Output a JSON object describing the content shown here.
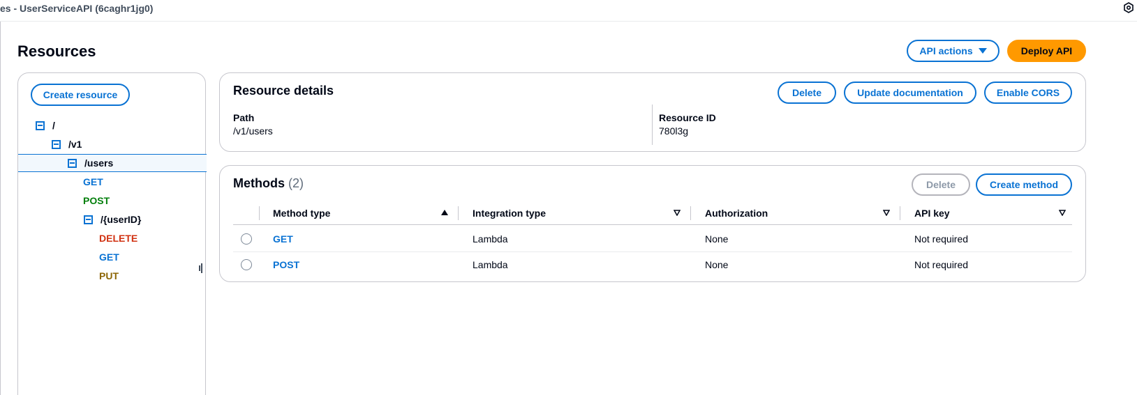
{
  "topbar": {
    "title": "es - UserServiceAPI (6caghr1jg0)",
    "icon": "hexagon-settings-icon"
  },
  "page": {
    "title": "Resources"
  },
  "header_actions": {
    "api_actions_label": "API actions",
    "deploy_label": "Deploy API"
  },
  "tree": {
    "create_resource_label": "Create resource",
    "nodes": [
      {
        "label": "/",
        "kind": "resource"
      },
      {
        "label": "/v1",
        "kind": "resource"
      },
      {
        "label": "/users",
        "kind": "resource",
        "selected": true
      },
      {
        "label": "GET",
        "kind": "method"
      },
      {
        "label": "POST",
        "kind": "method"
      },
      {
        "label": "/{userID}",
        "kind": "resource"
      },
      {
        "label": "DELETE",
        "kind": "method"
      },
      {
        "label": "GET",
        "kind": "method"
      },
      {
        "label": "PUT",
        "kind": "method"
      }
    ]
  },
  "details": {
    "title": "Resource details",
    "delete_label": "Delete",
    "update_doc_label": "Update documentation",
    "enable_cors_label": "Enable CORS",
    "path_label": "Path",
    "path_value": "/v1/users",
    "resource_id_label": "Resource ID",
    "resource_id_value": "780l3g"
  },
  "methods": {
    "title": "Methods",
    "count": "(2)",
    "delete_label": "Delete",
    "create_label": "Create method",
    "columns": [
      "Method type",
      "Integration type",
      "Authorization",
      "API key"
    ],
    "rows": [
      {
        "method": "GET",
        "integration": "Lambda",
        "authorization": "None",
        "api_key": "Not required"
      },
      {
        "method": "POST",
        "integration": "Lambda",
        "authorization": "None",
        "api_key": "Not required"
      }
    ]
  },
  "colors": {
    "link_blue": "#0972d3",
    "primary_orange": "#ff9900",
    "get": "#0972d3",
    "post": "#037f0c",
    "delete": "#d13212",
    "put": "#8d6605"
  }
}
